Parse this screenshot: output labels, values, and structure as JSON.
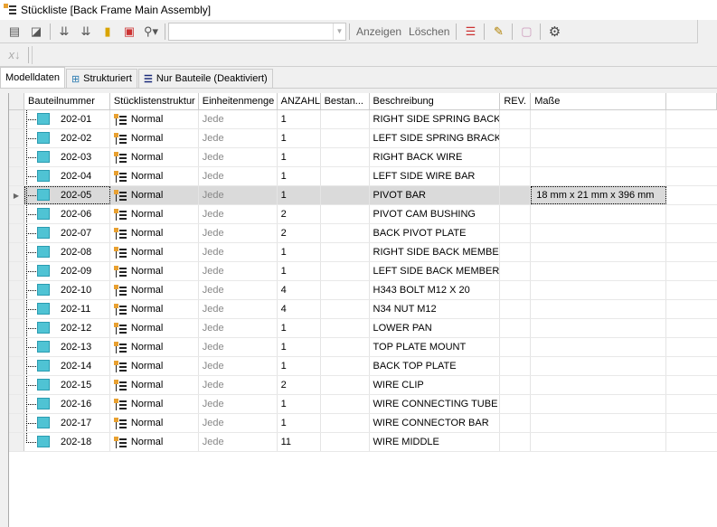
{
  "window": {
    "title": "Stückliste [Back Frame Main Assembly]"
  },
  "toolbar": {
    "show_label": "Anzeigen",
    "clear_label": "Löschen",
    "filter_value": ""
  },
  "tabs": [
    {
      "label": "Modelldaten"
    },
    {
      "label": "Strukturiert"
    },
    {
      "label": "Nur Bauteile (Deaktiviert)"
    }
  ],
  "columns": [
    "Bauteilnummer",
    "Stücklistenstruktur",
    "Einheitenmenge",
    "ANZAHL",
    "Bestan...",
    "Beschreibung",
    "REV.",
    "Maße"
  ],
  "selected_row": 4,
  "rows": [
    {
      "part": "202-01",
      "struct": "Normal",
      "unit": "Jede",
      "qty": "1",
      "desc": "RIGHT SIDE SPRING BACKET",
      "dims": ""
    },
    {
      "part": "202-02",
      "struct": "Normal",
      "unit": "Jede",
      "qty": "1",
      "desc": "LEFT SIDE SPRING BRACKET",
      "dims": ""
    },
    {
      "part": "202-03",
      "struct": "Normal",
      "unit": "Jede",
      "qty": "1",
      "desc": "RIGHT BACK WIRE",
      "dims": ""
    },
    {
      "part": "202-04",
      "struct": "Normal",
      "unit": "Jede",
      "qty": "1",
      "desc": "LEFT SIDE WIRE BAR",
      "dims": ""
    },
    {
      "part": "202-05",
      "struct": "Normal",
      "unit": "Jede",
      "qty": "1",
      "desc": "PIVOT BAR",
      "dims": "18 mm x 21 mm x 396 mm"
    },
    {
      "part": "202-06",
      "struct": "Normal",
      "unit": "Jede",
      "qty": "2",
      "desc": "PIVOT CAM BUSHING",
      "dims": ""
    },
    {
      "part": "202-07",
      "struct": "Normal",
      "unit": "Jede",
      "qty": "2",
      "desc": "BACK PIVOT PLATE",
      "dims": ""
    },
    {
      "part": "202-08",
      "struct": "Normal",
      "unit": "Jede",
      "qty": "1",
      "desc": "RIGHT SIDE BACK MEMBER",
      "dims": ""
    },
    {
      "part": "202-09",
      "struct": "Normal",
      "unit": "Jede",
      "qty": "1",
      "desc": "LEFT SIDE BACK MEMBER",
      "dims": ""
    },
    {
      "part": "202-10",
      "struct": "Normal",
      "unit": "Jede",
      "qty": "4",
      "desc": "H343 BOLT M12 X 20",
      "dims": ""
    },
    {
      "part": "202-11",
      "struct": "Normal",
      "unit": "Jede",
      "qty": "4",
      "desc": "N34 NUT M12",
      "dims": ""
    },
    {
      "part": "202-12",
      "struct": "Normal",
      "unit": "Jede",
      "qty": "1",
      "desc": "LOWER PAN",
      "dims": ""
    },
    {
      "part": "202-13",
      "struct": "Normal",
      "unit": "Jede",
      "qty": "1",
      "desc": "TOP PLATE MOUNT",
      "dims": ""
    },
    {
      "part": "202-14",
      "struct": "Normal",
      "unit": "Jede",
      "qty": "1",
      "desc": "BACK TOP PLATE",
      "dims": ""
    },
    {
      "part": "202-15",
      "struct": "Normal",
      "unit": "Jede",
      "qty": "2",
      "desc": "WIRE CLIP",
      "dims": ""
    },
    {
      "part": "202-16",
      "struct": "Normal",
      "unit": "Jede",
      "qty": "1",
      "desc": "WIRE CONNECTING TUBE",
      "dims": ""
    },
    {
      "part": "202-17",
      "struct": "Normal",
      "unit": "Jede",
      "qty": "1",
      "desc": "WIRE CONNECTOR BAR",
      "dims": ""
    },
    {
      "part": "202-18",
      "struct": "Normal",
      "unit": "Jede",
      "qty": "11",
      "desc": "WIRE MIDDLE",
      "dims": ""
    }
  ]
}
